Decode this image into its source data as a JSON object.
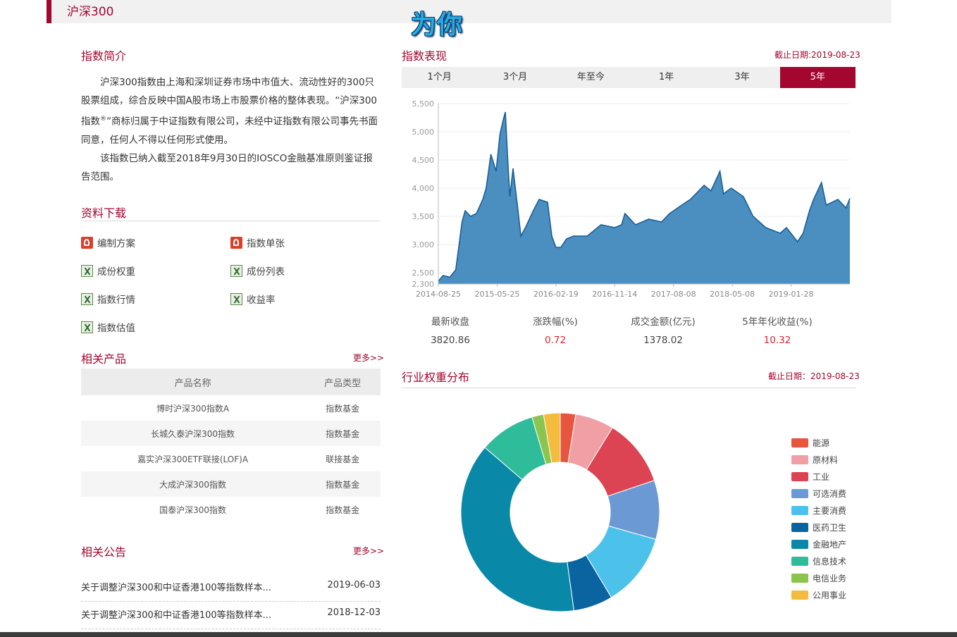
{
  "header": {
    "title": "沪深300",
    "watermark": "为你"
  },
  "intro": {
    "title": "指数简介",
    "p1a": "沪深300指数由上海和深圳证券市场中市值大、流动性好的300只股票组成，综合反映中国A股市场上市股票价格的整体表现。“沪深300指数",
    "p1reg": "®",
    "p1b": "”商标归属于中证指数有限公司，未经中证指数有限公司事先书面同意，任何人不得以任何形式使用。",
    "p2": "该指数已纳入截至2018年9月30日的IOSCO金融基准原则鉴证报告范围。"
  },
  "downloads": {
    "title": "资料下载",
    "items": [
      {
        "label": "编制方案",
        "icon": "pdf-icon"
      },
      {
        "label": "指数单张",
        "icon": "pdf-icon"
      },
      {
        "label": "成份权重",
        "icon": "excel-icon"
      },
      {
        "label": "成份列表",
        "icon": "excel-icon"
      },
      {
        "label": "指数行情",
        "icon": "excel-icon"
      },
      {
        "label": "收益率",
        "icon": "excel-icon"
      },
      {
        "label": "指数估值",
        "icon": "excel-icon"
      }
    ]
  },
  "products": {
    "title": "相关产品",
    "more": "更多>>",
    "headers": [
      "产品名称",
      "产品类型"
    ],
    "rows": [
      [
        "博时沪深300指数A",
        "指数基金"
      ],
      [
        "长城久泰沪深300指数",
        "指数基金"
      ],
      [
        "嘉实沪深300ETF联接(LOF)A",
        "联接基金"
      ],
      [
        "大成沪深300指数",
        "指数基金"
      ],
      [
        "国泰沪深300指数",
        "指数基金"
      ]
    ]
  },
  "announcements": {
    "title": "相关公告",
    "more": "更多>>",
    "items": [
      {
        "title": "关于调整沪深300和中证香港100等指数样本...",
        "date": "2019-06-03"
      },
      {
        "title": "关于调整沪深300和中证香港100等指数样本...",
        "date": "2018-12-03"
      }
    ]
  },
  "performance": {
    "title": "指数表现",
    "as_of": "截止日期:2019-08-23",
    "tabs": [
      "1个月",
      "3个月",
      "年至今",
      "1年",
      "3年",
      "5年"
    ],
    "active_tab": "5年",
    "stats": [
      {
        "label": "最新收盘",
        "value": "3820.86",
        "highlight": false
      },
      {
        "label": "涨跌幅(%)",
        "value": "0.72",
        "highlight": true
      },
      {
        "label": "成交金额(亿元)",
        "value": "1378.02",
        "highlight": false
      },
      {
        "label": "5年年化收益(%)",
        "value": "10.32",
        "highlight": true
      }
    ]
  },
  "chart_data": [
    {
      "type": "area",
      "title": "",
      "xlabel": "",
      "ylabel": "",
      "ylim": [
        2300,
        5500
      ],
      "yticks": [
        2300,
        2500,
        3000,
        3500,
        4000,
        4500,
        5000,
        5500
      ],
      "ytick_labels": [
        "2,300",
        "2,500",
        "3,000",
        "3,500",
        "4,000",
        "4,500",
        "5,000",
        "5,500"
      ],
      "xtick_labels": [
        "2014-08-25",
        "2015-05-25",
        "2016-02-19",
        "2016-11-14",
        "2017-08-08",
        "2018-05-08",
        "2019-01-28"
      ],
      "grid": true,
      "color": "#4a8fc0",
      "line_color": "#1a5f96",
      "x": [
        "2014-08-25",
        "2014-09-15",
        "2014-10-15",
        "2014-11-10",
        "2014-11-25",
        "2014-12-08",
        "2014-12-22",
        "2015-01-15",
        "2015-02-10",
        "2015-03-10",
        "2015-03-25",
        "2015-04-15",
        "2015-05-08",
        "2015-05-25",
        "2015-06-08",
        "2015-06-18",
        "2015-06-30",
        "2015-07-08",
        "2015-07-22",
        "2015-08-10",
        "2015-08-26",
        "2015-09-15",
        "2015-10-20",
        "2015-11-15",
        "2015-12-22",
        "2016-01-10",
        "2016-01-28",
        "2016-02-19",
        "2016-03-15",
        "2016-04-15",
        "2016-06-15",
        "2016-08-15",
        "2016-10-15",
        "2016-11-14",
        "2016-11-29",
        "2017-01-15",
        "2017-03-15",
        "2017-05-10",
        "2017-06-15",
        "2017-08-08",
        "2017-09-15",
        "2017-11-15",
        "2017-12-15",
        "2018-01-24",
        "2018-02-09",
        "2018-03-15",
        "2018-05-08",
        "2018-06-20",
        "2018-08-15",
        "2018-10-18",
        "2018-11-15",
        "2019-01-03",
        "2019-01-28",
        "2019-02-25",
        "2019-03-15",
        "2019-04-19",
        "2019-05-10",
        "2019-06-06",
        "2019-07-01",
        "2019-08-06",
        "2019-08-23"
      ],
      "values": [
        2350,
        2450,
        2420,
        2550,
        3000,
        3400,
        3600,
        3500,
        3550,
        3800,
        4000,
        4600,
        4300,
        4950,
        5200,
        5350,
        4400,
        3850,
        4350,
        3700,
        3150,
        3300,
        3600,
        3800,
        3750,
        3150,
        2950,
        2950,
        3100,
        3150,
        3150,
        3350,
        3300,
        3350,
        3550,
        3350,
        3450,
        3400,
        3550,
        3700,
        3800,
        4050,
        3950,
        4300,
        3900,
        4000,
        3850,
        3500,
        3300,
        3200,
        3300,
        3050,
        3200,
        3600,
        3800,
        4100,
        3700,
        3750,
        3800,
        3650,
        3820
      ]
    },
    {
      "type": "pie",
      "title": "行业权重分布",
      "as_of": "截止日期：2019-08-23",
      "categories": [
        "能源",
        "原材料",
        "工业",
        "可选消费",
        "主要消费",
        "医药卫生",
        "金融地产",
        "信息技术",
        "电信业务",
        "公用事业"
      ],
      "values": [
        2.5,
        6.3,
        11.0,
        9.6,
        12.0,
        6.4,
        38.5,
        9.1,
        1.9,
        2.7
      ],
      "colors": [
        "#e8553f",
        "#f0a0a4",
        "#dc4353",
        "#6b99d3",
        "#4cc2eb",
        "#0a64a0",
        "#0a88a8",
        "#2fbc9a",
        "#8bc44f",
        "#f3bc3c"
      ]
    }
  ]
}
